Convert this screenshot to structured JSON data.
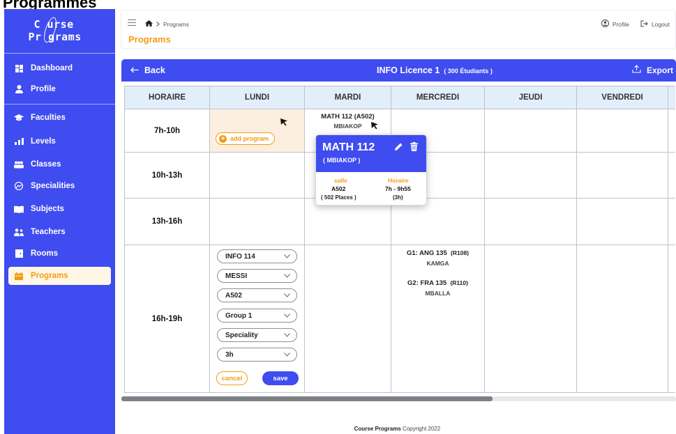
{
  "page_heading": "Programmes",
  "logo": {
    "line1": "C urse",
    "line2": "Pr grams"
  },
  "sidebar": {
    "items": [
      {
        "label": "Dashboard",
        "icon": "dashboard-icon"
      },
      {
        "label": "Profile",
        "icon": "user-icon"
      },
      {
        "label": "Faculties",
        "icon": "graduation-cap-icon"
      },
      {
        "label": "Levels",
        "icon": "bar-chart-icon"
      },
      {
        "label": "Classes",
        "icon": "people-icon"
      },
      {
        "label": "Specialities",
        "icon": "speciality-icon"
      },
      {
        "label": "Subjects",
        "icon": "book-icon"
      },
      {
        "label": "Teachers",
        "icon": "teacher-icon"
      },
      {
        "label": "Rooms",
        "icon": "door-icon"
      },
      {
        "label": "Programs",
        "icon": "calendar-icon",
        "active": true
      }
    ]
  },
  "topbar": {
    "breadcrumb": "Programs",
    "title": "Programs",
    "profile": "Profile",
    "logout": "Logout"
  },
  "board": {
    "back": "Back",
    "title": "INFO Licence 1",
    "students": "( 300 Étudiants )",
    "export": "Export"
  },
  "grid": {
    "columns": [
      "HORAIRE",
      "LUNDI",
      "MARDI",
      "MERCREDI",
      "JEUDI",
      "VENDREDI"
    ],
    "hours": [
      "7h-10h",
      "10h-13h",
      "13h-16h",
      "16h-19h"
    ]
  },
  "add_program": "add program",
  "math_cell": {
    "course": "MATH 112  (A502)",
    "teacher": "MBIAKOP"
  },
  "popover": {
    "title": "MATH 112",
    "teacher": "( MBIAKOP )",
    "salle_label": "salle",
    "salle_value": "A502",
    "salle_places": "( 502 Places )",
    "horaire_label": "Horaire",
    "horaire_value": "7h - 9h55",
    "horaire_duration": "(3h)"
  },
  "wed_cell": {
    "g1_course": "G1: ANG 135",
    "g1_room": "(R108)",
    "g1_teacher": "KAMGA",
    "g2_course": "G2: FRA 135",
    "g2_room": "(R110)",
    "g2_teacher": "MBALLA"
  },
  "form": {
    "selects": [
      "INFO 114",
      "MESSI",
      "A502",
      "Group 1",
      "Speciality",
      "3h"
    ],
    "cancel": "cancel",
    "save": "save"
  },
  "footer": {
    "brand": "Course Programs",
    "text": "Copyright 2022"
  },
  "colors": {
    "primary": "#3f4cf0",
    "accent": "#f39c12",
    "header_cell": "#e3eefb"
  }
}
